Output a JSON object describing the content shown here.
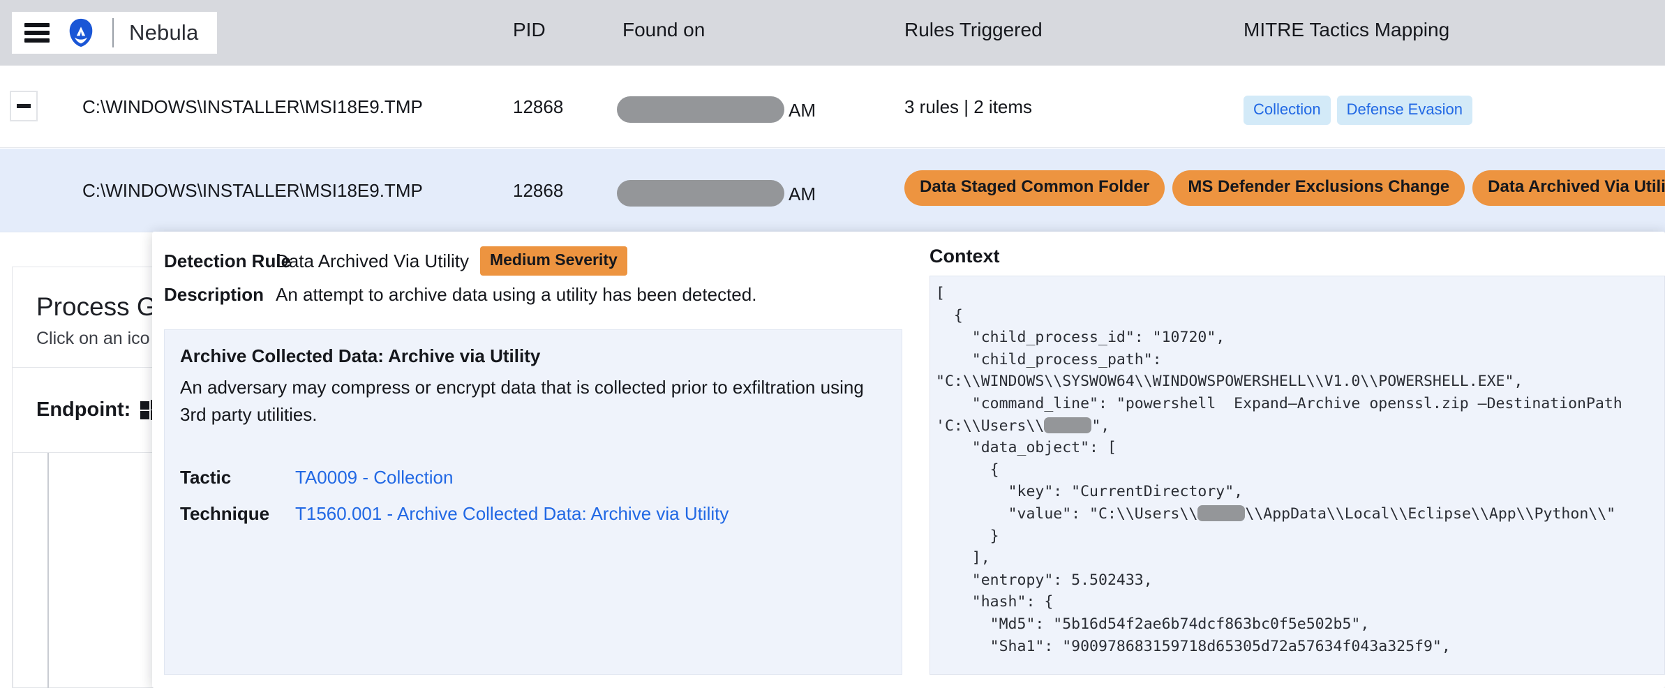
{
  "header": {
    "brand": "Nebula",
    "menu_icon": "hamburger-icon",
    "logo_icon": "malwarebytes-logo-icon",
    "columns": {
      "pid": "PID",
      "found_on": "Found on",
      "rules_triggered": "Rules Triggered",
      "mitre": "MITRE Tactics Mapping"
    }
  },
  "rows": [
    {
      "expander": "−",
      "path": "C:\\WINDOWS\\INSTALLER\\MSI18E9.TMP",
      "pid": "12868",
      "found_on_suffix": "AM",
      "found_on_redacted": true,
      "rules_summary": "3 rules | 2 items",
      "mitre_tags": [
        "Collection",
        "Defense Evasion"
      ]
    },
    {
      "path": "C:\\WINDOWS\\INSTALLER\\MSI18E9.TMP",
      "pid": "12868",
      "found_on_suffix": "AM",
      "found_on_redacted": true,
      "rule_pills": [
        "Data Staged Common Folder",
        "MS Defender Exclusions Change",
        "Data Archived Via Utility"
      ]
    }
  ],
  "background_panel": {
    "title": "Process G",
    "subtitle": "Click on an ico",
    "endpoint_label": "Endpoint:",
    "endpoint_icon": "windows-logo-icon"
  },
  "detail": {
    "detection_rule_label": "Detection Rule",
    "detection_rule_value": "Data Archived Via Utility",
    "severity_badge": "Medium Severity",
    "description_label": "Description",
    "description_value": "An attempt to archive data using a utility has been detected.",
    "technique_title": "Archive Collected Data: Archive via Utility",
    "technique_body": "An adversary may compress or encrypt data that is collected prior to exfiltration using 3rd party utilities.",
    "tactic_label": "Tactic",
    "tactic_link": "TA0009 - Collection",
    "technique_label": "Technique",
    "technique_link": "T1560.001 - Archive Collected Data: Archive via Utility"
  },
  "context": {
    "title": "Context",
    "json_part_1": "[\n  {\n    \"child_process_id\": \"10720\",\n    \"child_process_path\":\n\"C:\\\\WINDOWS\\\\SYSWOW64\\\\WINDOWSPOWERSHELL\\\\V1.0\\\\POWERSHELL.EXE\",\n    \"command_line\": \"powershell  Expand–Archive openssl.zip –DestinationPath\n'C:\\\\Users\\\\",
    "json_part_2": "\",\n    \"data_object\": [\n      {\n        \"key\": \"CurrentDirectory\",\n        \"value\": \"C:\\\\Users\\\\",
    "json_part_3": "\\\\AppData\\\\Local\\\\Eclipse\\\\App\\\\Python\\\\\"\n      }\n    ],\n    \"entropy\": 5.502433,\n    \"hash\": {\n      \"Md5\": \"5b16d54f2ae6b74dcf863bc0f5e502b5\",\n      \"Sha1\": \"900978683159718d65305d72a57634f043a325f9\","
  },
  "colors": {
    "header_bg": "#d7d9de",
    "row_highlight": "#e4ecfa",
    "pill_orange": "#ed9440",
    "tag_blue_bg": "#d3eaf8",
    "tag_blue_text": "#2168e4",
    "link_blue": "#2168e4",
    "brand_blue": "#1a56d6",
    "info_bg": "#eff3fb",
    "redaction": "#949699"
  }
}
